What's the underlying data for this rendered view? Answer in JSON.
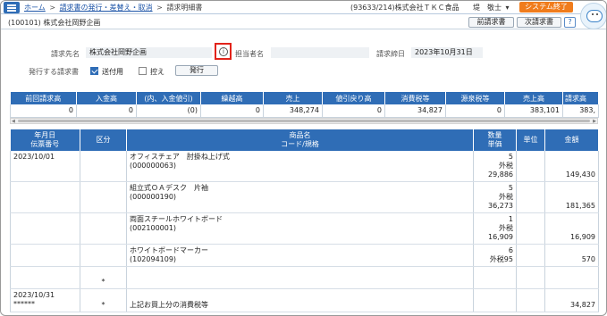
{
  "nav": {
    "home": "ホーム",
    "issue": "請求書の発行・差替え・取消",
    "current": "請求明細書",
    "sep": ">"
  },
  "company": "(93633/214)株式会社ＴＫＣ食品",
  "user": "堤　敬士",
  "user_caret": "▾",
  "system_end": "システム終了",
  "customer_header": "(100101) 株式会社岡野企画",
  "buttons": {
    "prev": "前請求書",
    "next": "次請求書",
    "help": "?"
  },
  "form": {
    "billing_to_label": "請求先名",
    "billing_to_value": "株式会社岡野企画",
    "info_icon": "i",
    "person_label": "担当者名",
    "person_value": "",
    "close_date_label": "請求締日",
    "close_date_value": "2023年10月31日",
    "issue_doc_label": "発行する請求書",
    "send_label": "送付用",
    "copy_label": "控え",
    "issue_button": "発行"
  },
  "summary": {
    "headers": [
      "前回請求高",
      "入金高",
      "(内、入金値引)",
      "繰越高",
      "売上",
      "値引戻り高",
      "消費税等",
      "源泉税等",
      "売上高",
      "請求高"
    ],
    "values": [
      "0",
      "0",
      "(0)",
      "0",
      "348,274",
      "0",
      "34,827",
      "0",
      "383,101",
      "383,"
    ]
  },
  "scroll": {
    "left": "◀",
    "right": "▶"
  },
  "detail": {
    "headers": {
      "date_1": "年月日",
      "date_2": "伝票番号",
      "kubun": "区分",
      "item_1": "商品名",
      "item_2": "コード/規格",
      "qty_1": "数量",
      "qty_2": "単価",
      "unit": "単位",
      "amount": "金額"
    },
    "rows": [
      {
        "date": "2023/10/01",
        "slip": "",
        "kubun": "",
        "name": "オフィスチェア　肘掛ね上げ式",
        "code": "(000000063)",
        "qty": "5",
        "price": "外税29,886",
        "unit": "",
        "amount": "149,430"
      },
      {
        "date": "",
        "slip": "",
        "kubun": "",
        "name": "組立式ＯＡデスク　片袖",
        "code": "(000000190)",
        "qty": "5",
        "price": "外税36,273",
        "unit": "",
        "amount": "181,365"
      },
      {
        "date": "",
        "slip": "",
        "kubun": "",
        "name": "両面スチールホワイトボード",
        "code": "(002100001)",
        "qty": "1",
        "price": "外税16,909",
        "unit": "",
        "amount": "16,909"
      },
      {
        "date": "",
        "slip": "",
        "kubun": "",
        "name": "ホワイトボードマーカー",
        "code": "(102094109)",
        "qty": "6",
        "price": "外税95",
        "unit": "",
        "amount": "570"
      },
      {
        "date": "",
        "slip": "",
        "kubun": "*",
        "name": "",
        "code": "",
        "qty": "",
        "price": "",
        "unit": "",
        "amount": ""
      },
      {
        "date": "2023/10/31",
        "slip": "******",
        "kubun": "*",
        "name": "上記お買上分の消費税等",
        "code": "",
        "qty": "",
        "price": "",
        "unit": "",
        "amount": "34,827"
      }
    ]
  }
}
